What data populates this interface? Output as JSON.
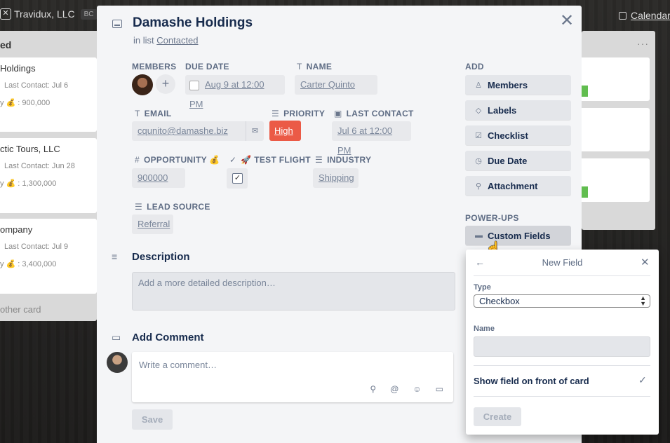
{
  "board": {
    "name": "Travidux, LLC",
    "badge": "BC",
    "calendar_label": "Calendar"
  },
  "left_list": {
    "title": "ed",
    "cards": [
      {
        "title": "Holdings",
        "last_contact": "Last Contact: Jul 6",
        "opportunity": "y 💰 : 900,000"
      },
      {
        "title": "ctic Tours, LLC",
        "last_contact": "Last Contact: Jun 28",
        "opportunity": "y 💰 : 1,300,000"
      },
      {
        "title": "ompany",
        "last_contact": "Last Contact: Jul 9",
        "opportunity": "y 💰 : 3,400,000"
      }
    ],
    "add_card": "other card"
  },
  "right_list": {
    "menu": "···",
    "badge_color": "#61bd4f"
  },
  "card": {
    "title": "Damashe Holdings",
    "in_list_prefix": "in list",
    "list_name": "Contacted",
    "fields": {
      "members_label": "Members",
      "add_member": "+",
      "due_date_label": "Due Date",
      "due_date_value": "Aug 9 at 12:00 PM",
      "name_label": "Name",
      "name_value": "Carter Quinto",
      "email_label": "Email",
      "email_value": "cqunito@damashe.biz",
      "priority_label": "Priority",
      "priority_value": "High",
      "priority_color": "#eb5a46",
      "last_contact_label": "Last Contact",
      "last_contact_value": "Jul 6 at 12:00 PM",
      "opportunity_label": "Opportunity 💰",
      "opportunity_value": "900000",
      "test_flight_label": "🚀 Test Flight",
      "test_flight_checked": true,
      "industry_label": "Industry",
      "industry_value": "Shipping",
      "lead_source_label": "Lead Source",
      "lead_source_value": "Referral"
    },
    "description_heading": "Description",
    "description_placeholder": "Add a more detailed description…",
    "comment_heading": "Add Comment",
    "comment_placeholder": "Write a comment…",
    "save_label": "Save"
  },
  "sidebar": {
    "add_heading": "Add",
    "buttons": [
      "Members",
      "Labels",
      "Checklist",
      "Due Date",
      "Attachment"
    ],
    "powerups_heading": "Power-Ups",
    "custom_fields": "Custom Fields"
  },
  "popover": {
    "title": "New Field",
    "type_label": "Type",
    "type_value": "Checkbox",
    "name_label": "Name",
    "name_value": "",
    "show_front_label": "Show field on front of card",
    "show_front_checked": true,
    "create_label": "Create"
  }
}
